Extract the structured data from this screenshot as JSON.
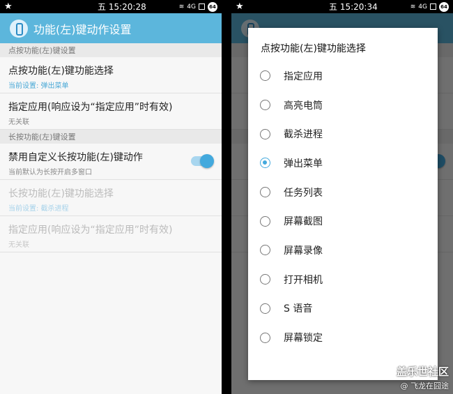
{
  "left": {
    "statusbar": {
      "time": "五 15:20:28",
      "network": "4G",
      "battery": "64"
    },
    "appbar": {
      "title": "功能(左)键动作设置"
    },
    "section1": {
      "header": "点按功能(左)键设置"
    },
    "row1": {
      "title": "点按功能(左)键功能选择",
      "subtitle": "当前设置: 弹出菜单"
    },
    "row2": {
      "title": "指定应用(响应设为“指定应用”时有效)",
      "subtitle": "无关联"
    },
    "section2": {
      "header": "长按功能(左)键设置"
    },
    "row3": {
      "title": "禁用自定义长按功能(左)键动作",
      "subtitle": "当前默认为长按开启多窗口",
      "toggle_on": true
    },
    "row4": {
      "title": "长按功能(左)键功能选择",
      "subtitle": "当前设置: 截杀进程"
    },
    "row5": {
      "title": "指定应用(响应设为“指定应用”时有效)",
      "subtitle": "无关联"
    }
  },
  "right": {
    "statusbar": {
      "time": "五 15:20:34",
      "network": "4G",
      "battery": "64"
    },
    "dialog": {
      "title": "点按功能(左)键功能选择",
      "options": [
        {
          "label": "指定应用",
          "selected": false
        },
        {
          "label": "高亮电筒",
          "selected": false
        },
        {
          "label": "截杀进程",
          "selected": false
        },
        {
          "label": "弹出菜单",
          "selected": true
        },
        {
          "label": "任务列表",
          "selected": false
        },
        {
          "label": "屏幕截图",
          "selected": false
        },
        {
          "label": "屏幕录像",
          "selected": false
        },
        {
          "label": "打开相机",
          "selected": false
        },
        {
          "label": "S 语音",
          "selected": false
        },
        {
          "label": "屏幕锁定",
          "selected": false
        }
      ]
    },
    "watermark": {
      "line1": "盖乐世社区",
      "line2": "@ 飞龙在囧途"
    }
  },
  "colors": {
    "accent": "#43a9dd",
    "appbar": "#5cb6dc"
  }
}
